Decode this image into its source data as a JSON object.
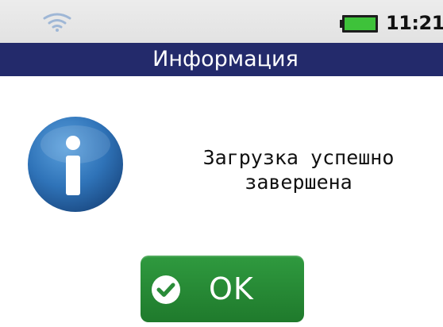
{
  "status_bar": {
    "time": "11:21",
    "wifi_icon": "wifi-icon",
    "battery_icon": "battery-icon",
    "battery_color": "#3ec23a"
  },
  "dialog": {
    "title": "Информация",
    "title_bar_color": "#232a6b",
    "icon": "info-icon",
    "icon_color": "#2f73b8",
    "message_line_1": "Загрузка успешно",
    "message_line_2": "завершена"
  },
  "ok_button": {
    "label": "OK",
    "icon": "check-icon",
    "color": "#2a8c39"
  }
}
